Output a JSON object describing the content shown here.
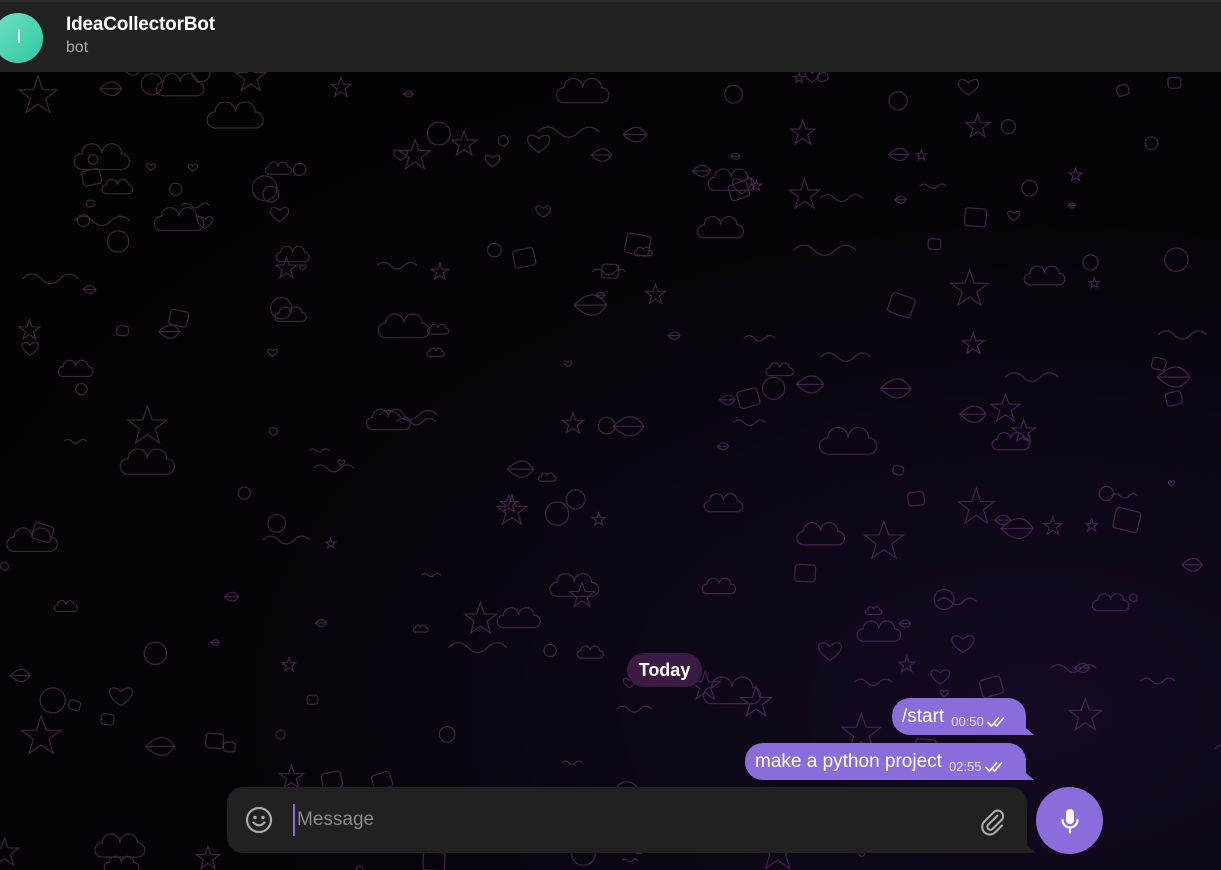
{
  "header": {
    "avatar_letter": "I",
    "title": "IdeaCollectorBot",
    "subtitle": "bot",
    "avatar_color": "#3fd3b0"
  },
  "chat": {
    "date_label": "Today",
    "messages": [
      {
        "text": "/start",
        "time": "00:50",
        "status": "read",
        "outgoing": true
      },
      {
        "text": "make a python project",
        "time": "02:55",
        "status": "read",
        "outgoing": true
      }
    ],
    "bubble_color": "#8b6cdb",
    "date_pill_color": "#3b1a44"
  },
  "composer": {
    "placeholder": "Message",
    "value": "",
    "emoji_icon": "smiley-icon",
    "attach_icon": "paperclip-icon",
    "send_icon": "microphone-icon"
  },
  "colors": {
    "header_bg": "#212121",
    "accent": "#8b6cdb"
  }
}
